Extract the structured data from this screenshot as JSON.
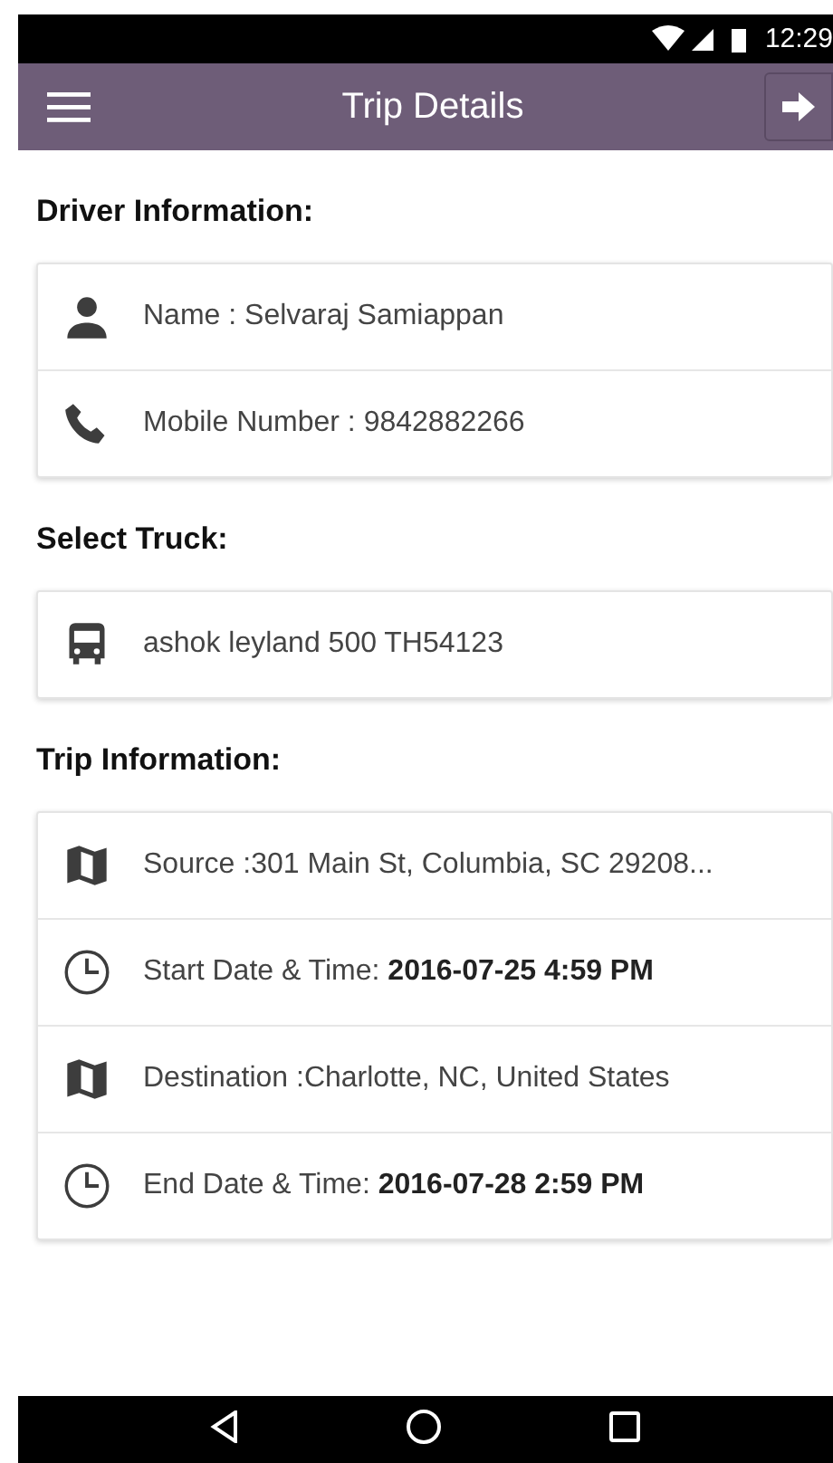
{
  "status_bar": {
    "time": "12:29"
  },
  "toolbar": {
    "title": "Trip Details"
  },
  "sections": [
    {
      "heading": "Driver Information:",
      "rows": [
        {
          "kind": "person",
          "label": "Name : Selvaraj Samiappan"
        },
        {
          "kind": "phone",
          "label": "Mobile Number : 9842882266"
        }
      ]
    },
    {
      "heading": "Select Truck:",
      "rows": [
        {
          "kind": "vehicle",
          "label": "ashok leyland 500 TH54123"
        }
      ]
    },
    {
      "heading": "Trip Information:",
      "rows": [
        {
          "kind": "place",
          "label": "Source :301 Main St, Columbia, SC 29208..."
        },
        {
          "kind": "time",
          "label": "Start Date & Time:",
          "value": "2016-07-25 4:59 PM"
        },
        {
          "kind": "place",
          "label": "Destination :Charlotte, NC, United States"
        },
        {
          "kind": "time",
          "label": "End Date & Time:",
          "value": "2016-07-28 2:59 PM"
        }
      ]
    }
  ]
}
